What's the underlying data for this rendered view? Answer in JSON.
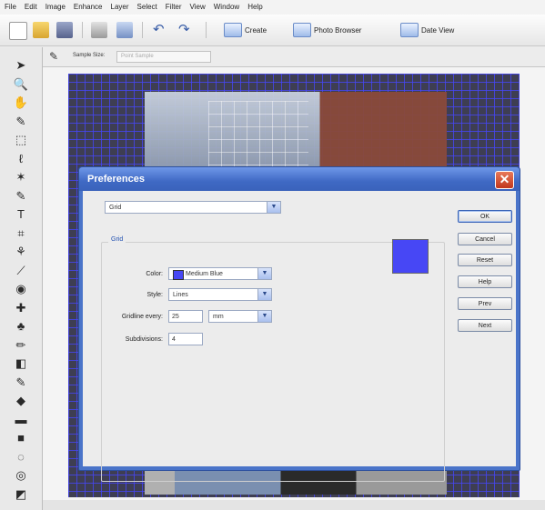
{
  "menu": [
    "File",
    "Edit",
    "Image",
    "Enhance",
    "Layer",
    "Select",
    "Filter",
    "View",
    "Window",
    "Help"
  ],
  "toolbar": {
    "create_label": "Create",
    "photo_browser_label": "Photo Browser",
    "date_view_label": "Date View"
  },
  "options_bar": {
    "sample_size_label": "Sample Size:",
    "sample_size_value": "Point Sample"
  },
  "dialog": {
    "title": "Preferences",
    "close_glyph": "✕",
    "section_select": "Grid",
    "group_label": "Grid",
    "color_label": "Color:",
    "color_value": "Medium Blue",
    "style_label": "Style:",
    "style_value": "Lines",
    "gridline_label": "Gridline every:",
    "gridline_value": "25",
    "gridline_unit": "mm",
    "subdivisions_label": "Subdivisions:",
    "subdivisions_value": "4",
    "swatch_color": "#4747f5",
    "buttons": [
      "OK",
      "Cancel",
      "Reset",
      "Help",
      "Prev",
      "Next"
    ]
  },
  "colors": {
    "grid_line": "#4646ff",
    "titlebar": "#3f69c4",
    "close_button": "#c1371d"
  },
  "tool_icons": [
    "move-tool-icon",
    "zoom-tool-icon",
    "hand-tool-icon",
    "eyedropper-tool-icon",
    "marquee-tool-icon",
    "lasso-tool-icon",
    "magic-wand-tool-icon",
    "selection-brush-tool-icon",
    "type-tool-icon",
    "crop-tool-icon",
    "cookie-cutter-tool-icon",
    "straighten-tool-icon",
    "red-eye-tool-icon",
    "healing-brush-tool-icon",
    "clone-stamp-tool-icon",
    "pencil-tool-icon",
    "eraser-tool-icon",
    "brush-tool-icon",
    "paint-bucket-tool-icon",
    "gradient-tool-icon",
    "shape-tool-icon",
    "blur-tool-icon",
    "sponge-tool-icon",
    "color-swatches-icon"
  ],
  "tool_glyphs": [
    "➤",
    "🔍",
    "✋",
    "✎",
    "⬚",
    "ℓ",
    "✶",
    "✎",
    "T",
    "⌗",
    "⚘",
    "⟋",
    "◉",
    "✚",
    "♣",
    "✏",
    "◧",
    "✎",
    "◆",
    "▬",
    "■",
    "◌",
    "◎",
    "◩"
  ]
}
